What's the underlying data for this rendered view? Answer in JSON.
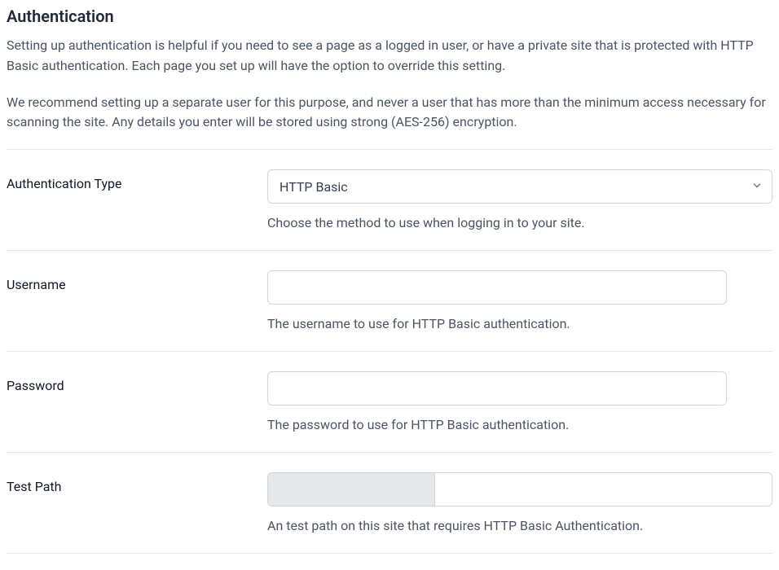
{
  "header": {
    "title": "Authentication",
    "desc_p1": "Setting up authentication is helpful if you need to see a page as a logged in user, or have a private site that is protected with HTTP Basic authentication. Each page you set up will have the option to override this setting.",
    "desc_p2": "We recommend setting up a separate user for this purpose, and never a user that has more than the minimum access necessary for scanning the site. Any details you enter will be stored using strong (AES-256) encryption."
  },
  "fields": {
    "auth_type": {
      "label": "Authentication Type",
      "value": "HTTP Basic",
      "help": "Choose the method to use when logging in to your site."
    },
    "username": {
      "label": "Username",
      "value": "",
      "help": "The username to use for HTTP Basic authentication."
    },
    "password": {
      "label": "Password",
      "value": "",
      "help": "The password to use for HTTP Basic authentication."
    },
    "test_path": {
      "label": "Test Path",
      "prefix": " ",
      "value": "",
      "help": "An test path on this site that requires HTTP Basic Authentication."
    }
  }
}
